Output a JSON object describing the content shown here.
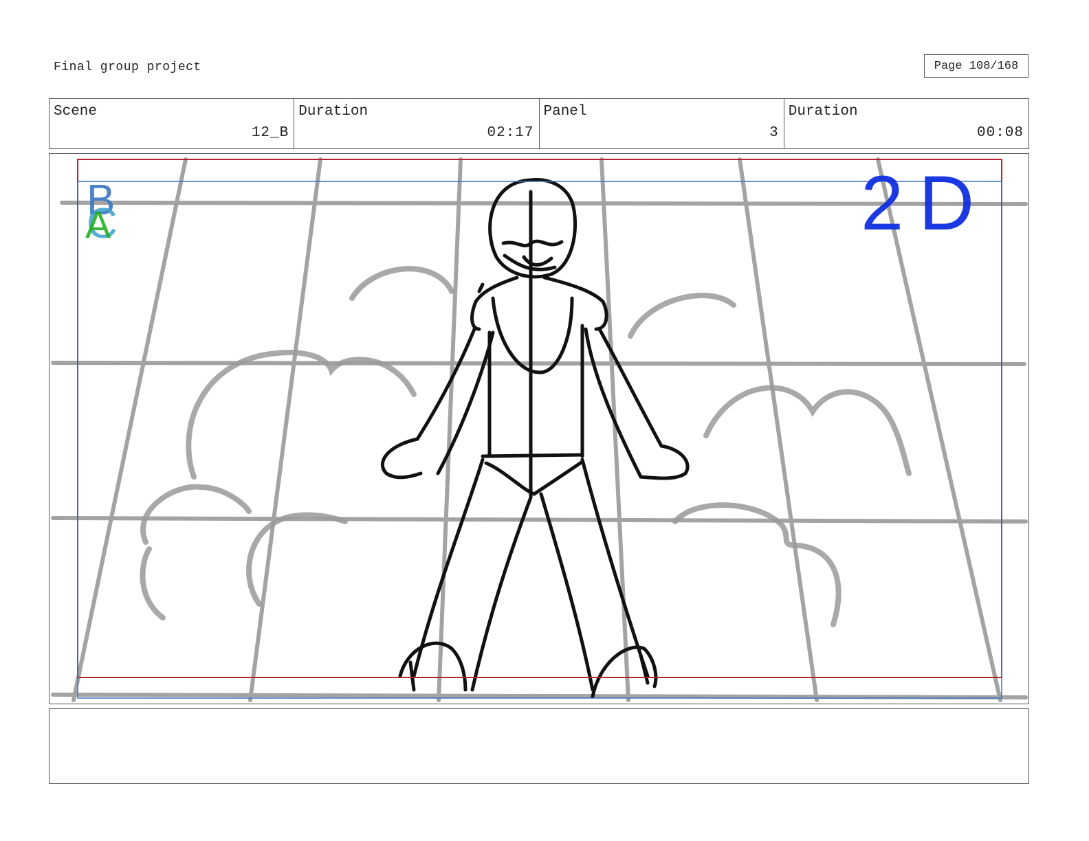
{
  "header": {
    "project_title": "Final group project",
    "page_indicator": "Page 108/168"
  },
  "info": {
    "scene_label": "Scene",
    "scene_value": "12_B",
    "scene_duration_label": "Duration",
    "scene_duration_value": "02:17",
    "panel_label": "Panel",
    "panel_value": "3",
    "panel_duration_label": "Duration",
    "panel_duration_value": "00:08"
  },
  "panel": {
    "layer_letters": [
      "B",
      "C",
      "A"
    ],
    "annotation": "2D",
    "colors": {
      "frame_red": "#b5242a",
      "guide_blue": "#3a74c4",
      "layer_b": "#3a74c4",
      "layer_c": "#3aa0c8",
      "layer_a": "#22b022",
      "annotation_blue": "#1030e0",
      "grid_gray": "#9a9a9a",
      "figure_black": "#111111"
    }
  },
  "notes": {
    "text": ""
  }
}
